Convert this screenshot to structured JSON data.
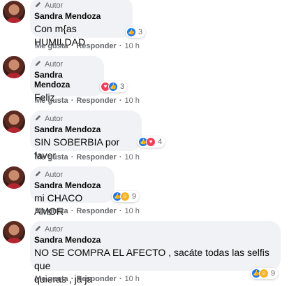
{
  "comments": [
    {
      "badge": "Autor",
      "name": "Sandra Mendoza",
      "text": "Con m{as HUMILDAD",
      "reactions": [
        "like"
      ],
      "count": "3",
      "like": "Me gusta",
      "reply": "Responder",
      "time": "10 h"
    },
    {
      "badge": "Autor",
      "name": "Sandra Mendoza",
      "text": "Feliz",
      "reactions": [
        "love",
        "like"
      ],
      "count": "3",
      "like": "Me gusta",
      "reply": "Responder",
      "time": "10 h"
    },
    {
      "badge": "Autor",
      "name": "Sandra Mendoza",
      "text": "SIN SOBERBIA por favor",
      "reactions": [
        "like",
        "love"
      ],
      "count": "4",
      "like": "Me gusta",
      "reply": "Responder",
      "time": "10 h"
    },
    {
      "badge": "Autor",
      "name": "Sandra Mendoza",
      "text": "mi CHACO AMOR",
      "reactions": [
        "like",
        "care"
      ],
      "count": "9",
      "like": "Me gusta",
      "reply": "Responder",
      "time": "10 h"
    },
    {
      "badge": "Autor",
      "name": "Sandra Mendoza",
      "text_line1": "NO SE COMPRA EL AFECTO , sacáte todas las selfis que",
      "text_line2": "quieras , ja ja",
      "reactions": [
        "like",
        "care"
      ],
      "count": "9",
      "like": "Me gusta",
      "reply": "Responder",
      "time": "10 h"
    }
  ],
  "separator": "·",
  "colors": {
    "like": "#1877f2",
    "love": "#f33e58",
    "care": "#f7b125",
    "bubble": "#f0f2f5",
    "meta": "#65676b"
  }
}
